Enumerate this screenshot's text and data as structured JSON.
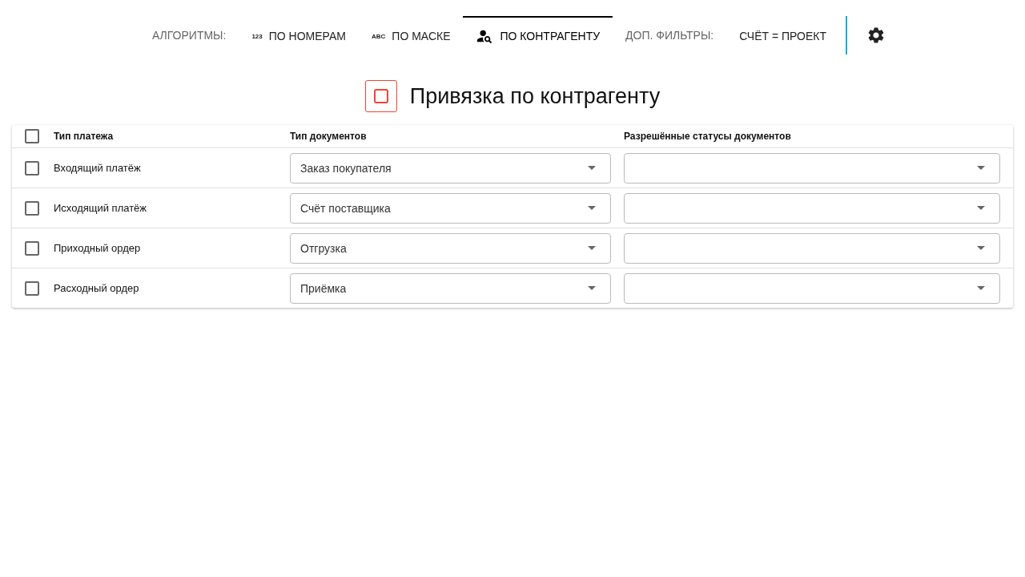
{
  "toolbar": [
    {
      "kind": "label",
      "label": "АЛГОРИТМЫ:"
    },
    {
      "kind": "text-icon-tab",
      "icon_text": "123",
      "label": "ПО НОМЕРАМ",
      "selected": false
    },
    {
      "kind": "text-icon-tab",
      "icon_text": "ABC",
      "label": "ПО МАСКЕ",
      "selected": false
    },
    {
      "kind": "person-tab",
      "label": "ПО КОНТРАГЕНТУ",
      "selected": true
    },
    {
      "kind": "label",
      "label": "ДОП. ФИЛЬТРЫ:"
    },
    {
      "kind": "tab",
      "label": "СЧЁТ = ПРОЕКТ",
      "selected": false
    }
  ],
  "section": {
    "title": "Привязка по контрагенту"
  },
  "table": {
    "header_checked": false,
    "columns": [
      "Тип платежа",
      "Тип документов",
      "Разрешённые статусы документов"
    ],
    "rows": [
      {
        "checked": false,
        "payment_type": "Входящий платёж",
        "document_type": "Заказ покупателя"
      },
      {
        "checked": false,
        "payment_type": "Исходящий платёж",
        "document_type": "Счёт поставщика"
      },
      {
        "checked": false,
        "payment_type": "Приходный ордер",
        "document_type": "Отгрузка"
      },
      {
        "checked": false,
        "payment_type": "Расходный ордер",
        "document_type": "Приёмка"
      }
    ]
  }
}
